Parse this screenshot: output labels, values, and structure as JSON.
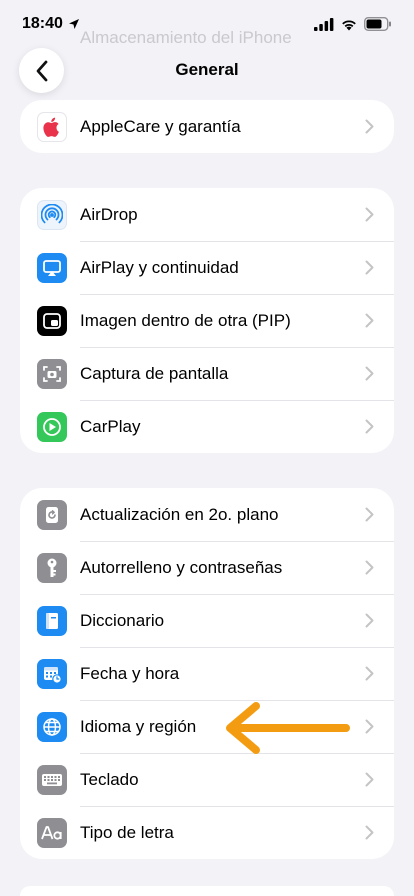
{
  "status": {
    "time": "18:40"
  },
  "ghost_title": "Almacenamiento del iPhone",
  "nav": {
    "title": "General"
  },
  "group1": [
    {
      "label": "AppleCare y garantía",
      "icon": "apple-icon",
      "color": "#ffffff"
    }
  ],
  "group2": [
    {
      "label": "AirDrop",
      "icon": "airdrop-icon",
      "color": "#e8f1fb"
    },
    {
      "label": "AirPlay y continuidad",
      "icon": "airplay-icon",
      "color": "#1d8bf2"
    },
    {
      "label": "Imagen dentro de otra (PIP)",
      "icon": "pip-icon",
      "color": "#000000"
    },
    {
      "label": "Captura de pantalla",
      "icon": "screenshot-icon",
      "color": "#8e8e93"
    },
    {
      "label": "CarPlay",
      "icon": "carplay-icon",
      "color": "#34c759"
    }
  ],
  "group3": [
    {
      "label": "Actualización en 2o. plano",
      "icon": "background-refresh-icon",
      "color": "#8e8e93"
    },
    {
      "label": "Autorrelleno y contraseñas",
      "icon": "key-icon",
      "color": "#8e8e93"
    },
    {
      "label": "Diccionario",
      "icon": "dictionary-icon",
      "color": "#1d8bf2"
    },
    {
      "label": "Fecha y hora",
      "icon": "calendar-clock-icon",
      "color": "#1d8bf2"
    },
    {
      "label": "Idioma y región",
      "icon": "globe-icon",
      "color": "#1d8bf2"
    },
    {
      "label": "Teclado",
      "icon": "keyboard-icon",
      "color": "#8e8e93"
    },
    {
      "label": "Tipo de letra",
      "icon": "font-icon",
      "color": "#8e8e93"
    }
  ],
  "annotation": {
    "arrow_color": "#f39c12",
    "arrow_points_to": "Idioma y región"
  }
}
